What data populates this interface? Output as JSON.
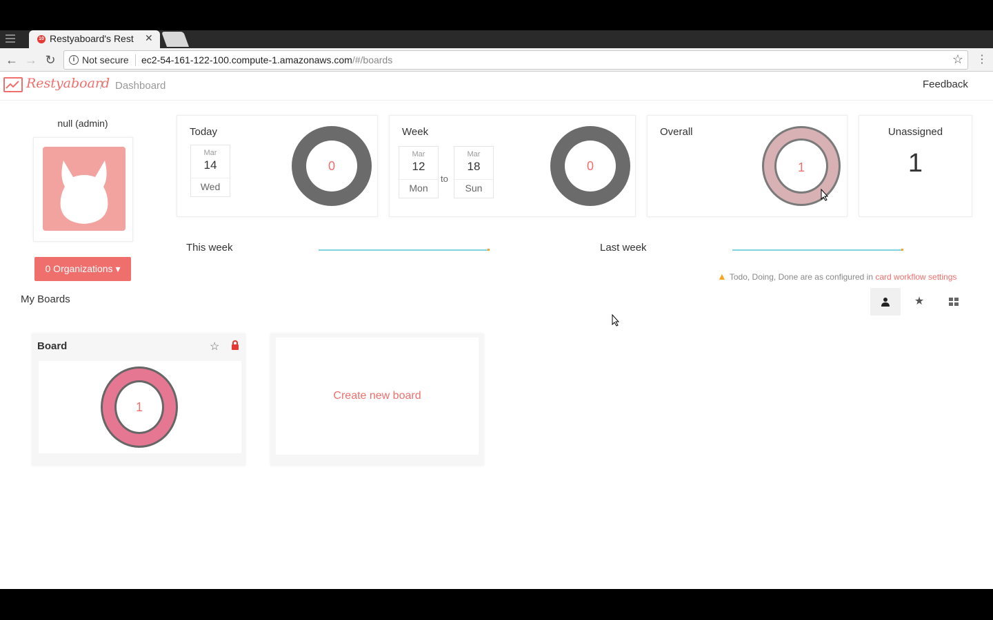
{
  "browser": {
    "tab_title": "Restyaboard's Rest",
    "tab_favicon": "10",
    "security_label": "Not secure",
    "url_host": "ec2-54-161-122-100.compute-1.amazonaws.com",
    "url_path": "/#/boards"
  },
  "header": {
    "logo_text": "Restyaboard",
    "breadcrumb_sep": "/",
    "breadcrumb": "Dashboard",
    "feedback": "Feedback"
  },
  "profile": {
    "username": "null (admin)",
    "org_button": "0 Organizations",
    "caret": "▾"
  },
  "stats": {
    "today": {
      "label": "Today",
      "month": "Mar",
      "day": "14",
      "weekday": "Wed",
      "count": "0"
    },
    "week": {
      "label": "Week",
      "start": {
        "month": "Mar",
        "day": "12",
        "weekday": "Mon"
      },
      "to": "to",
      "end": {
        "month": "Mar",
        "day": "18",
        "weekday": "Sun"
      },
      "count": "0"
    },
    "overall": {
      "label": "Overall",
      "count": "1"
    },
    "unassigned": {
      "label": "Unassigned",
      "count": "1"
    }
  },
  "trends": {
    "this_week": "This week",
    "last_week": "Last week"
  },
  "workflow_note": {
    "text": "Todo, Doing, Done are as configured in",
    "link": "card workflow settings"
  },
  "boards": {
    "heading": "My Boards",
    "items": [
      {
        "title": "Board",
        "count": "1"
      }
    ],
    "create_label": "Create new board"
  },
  "colors": {
    "accent": "#ef6f6c",
    "donut_empty": "#6b6b6b",
    "donut_overall": "#d7b1b3",
    "board_donut": "#e57792",
    "sparkline": "#7fd3df"
  }
}
